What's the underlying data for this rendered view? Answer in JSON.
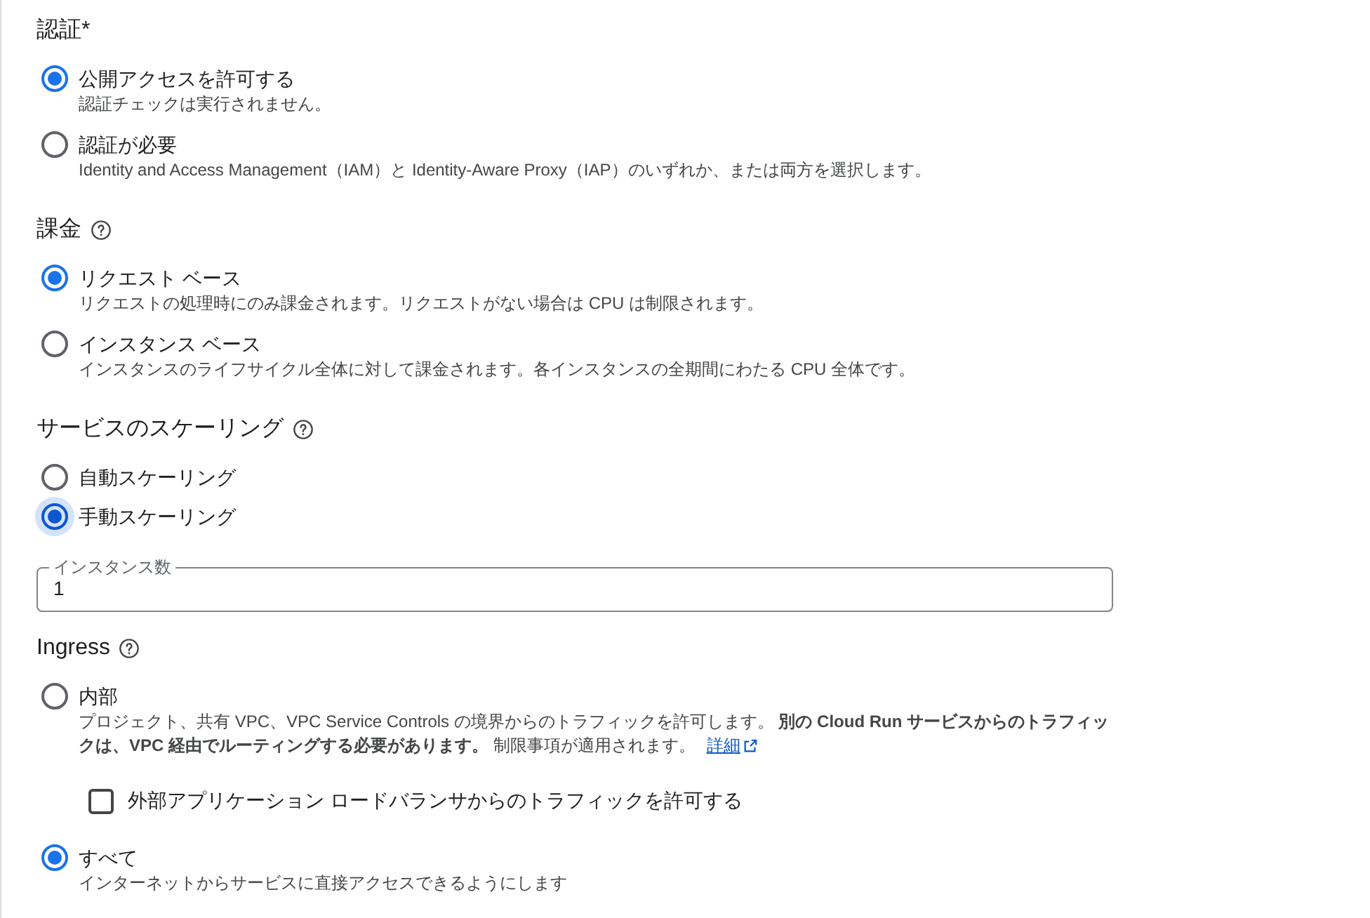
{
  "sections": [
    {
      "title": "認証*",
      "help": false,
      "options": [
        {
          "label": "公開アクセスを許可する",
          "description": "認証チェックは実行されません。",
          "selected": true,
          "focused": false
        },
        {
          "label": "認証が必要",
          "description": "Identity and Access Management（IAM）と Identity-Aware Proxy（IAP）のいずれか、または両方を選択します。",
          "selected": false,
          "focused": false
        }
      ]
    },
    {
      "title": "課金",
      "help": true,
      "options": [
        {
          "label": "リクエスト ベース",
          "description": "リクエストの処理時にのみ課金されます。リクエストがない場合は CPU は制限されます。",
          "selected": true,
          "focused": false
        },
        {
          "label": "インスタンス ベース",
          "description": "インスタンスのライフサイクル全体に対して課金されます。各インスタンスの全期間にわたる CPU 全体です。",
          "selected": false,
          "focused": false
        }
      ]
    },
    {
      "title": "サービスのスケーリング",
      "help": true,
      "options": [
        {
          "label": "自動スケーリング",
          "selected": false,
          "focused": false
        },
        {
          "label": "手動スケーリング",
          "selected": true,
          "focused": true
        }
      ],
      "field": {
        "label": "インスタンス数",
        "value": "1"
      }
    },
    {
      "title": "Ingress",
      "help": true,
      "options": [
        {
          "label": "内部",
          "description": "プロジェクト、共有 VPC、VPC Service Controls の境界からのトラフィックを許可します。 **別の Cloud Run サービスからのトラフィックは、VPC 経由でルーティングする必要があります。** 制限事項が適用されます。",
          "link": "詳細",
          "selected": false,
          "focused": false,
          "sub_option": {
            "label": "外部アプリケーション ロードバランサからのトラフィックを許可する",
            "checked": false
          }
        },
        {
          "label": "すべて",
          "description": "インターネットからサービスに直接アクセスできるようにします",
          "selected": true,
          "focused": false
        }
      ]
    }
  ]
}
